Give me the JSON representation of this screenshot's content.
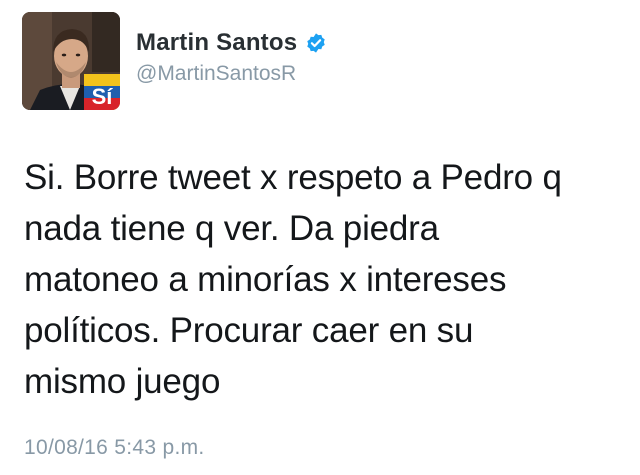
{
  "author": {
    "display_name": "Martin Santos",
    "handle": "@MartinSantosR",
    "verified": true,
    "avatar_badge_text": "Sí"
  },
  "tweet": {
    "lines": [
      "Si. Borre tweet x respeto a Pedro q",
      "nada tiene q ver. Da piedra",
      "matoneo a minorías x intereses",
      "políticos. Procurar caer en su",
      "mismo juego"
    ],
    "timestamp": "10/08/16 5:43 p.m."
  },
  "colors": {
    "verified_blue": "#1da1f2",
    "secondary_text": "#8899a6",
    "primary_text": "#14171a"
  },
  "icons": {
    "verified": "verified-badge-icon"
  }
}
